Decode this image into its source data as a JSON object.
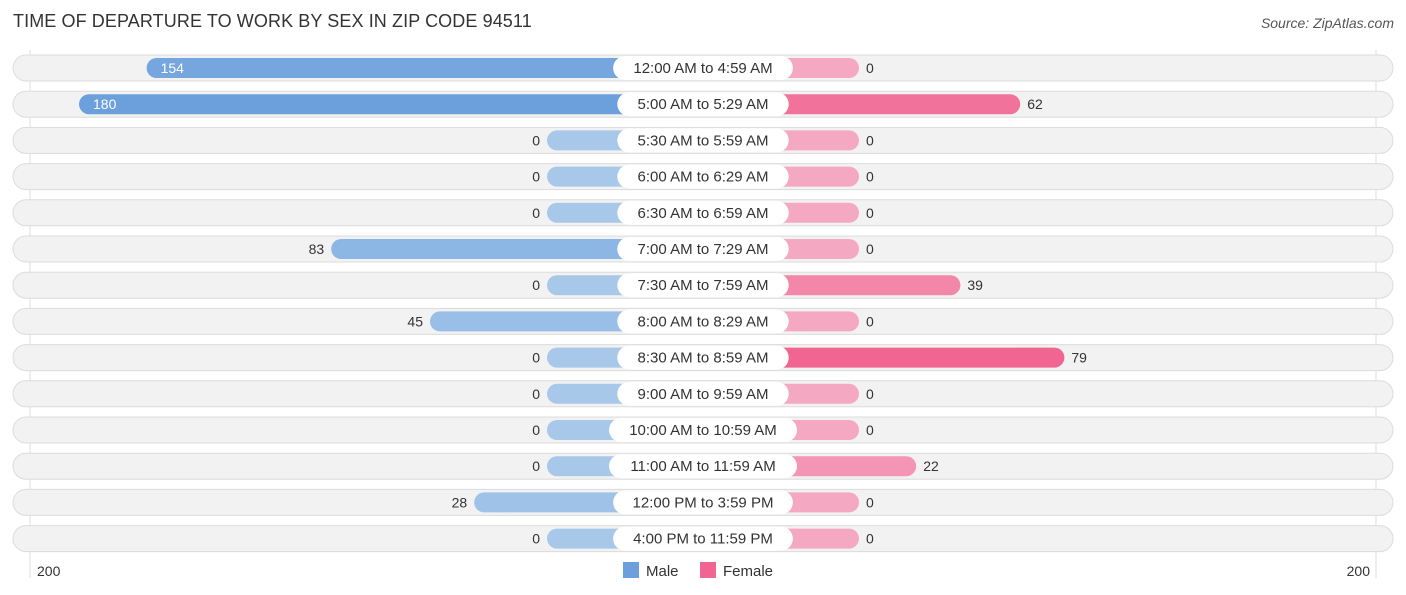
{
  "header": {
    "title": "TIME OF DEPARTURE TO WORK BY SEX IN ZIP CODE 94511",
    "source": "Source: ZipAtlas.com"
  },
  "colors": {
    "male": "#6ca0dc",
    "male_light": "#a8c8ea",
    "female": "#f06592",
    "female_light": "#f5a8c2",
    "row_bg": "#f2f2f2"
  },
  "chart_data": {
    "type": "bar",
    "orientation": "horizontal-diverging",
    "title": "TIME OF DEPARTURE TO WORK BY SEX IN ZIP CODE 94511",
    "categories": [
      "12:00 AM to 4:59 AM",
      "5:00 AM to 5:29 AM",
      "5:30 AM to 5:59 AM",
      "6:00 AM to 6:29 AM",
      "6:30 AM to 6:59 AM",
      "7:00 AM to 7:29 AM",
      "7:30 AM to 7:59 AM",
      "8:00 AM to 8:29 AM",
      "8:30 AM to 8:59 AM",
      "9:00 AM to 9:59 AM",
      "10:00 AM to 10:59 AM",
      "11:00 AM to 11:59 AM",
      "12:00 PM to 3:59 PM",
      "4:00 PM to 11:59 PM"
    ],
    "series": [
      {
        "name": "Male",
        "values": [
          154,
          180,
          0,
          0,
          0,
          83,
          0,
          45,
          0,
          0,
          0,
          0,
          28,
          0
        ]
      },
      {
        "name": "Female",
        "values": [
          0,
          62,
          0,
          0,
          0,
          0,
          39,
          0,
          79,
          0,
          0,
          22,
          0,
          0
        ]
      }
    ],
    "axis": {
      "left_label": "200",
      "right_label": "200",
      "max": 200
    },
    "legend": {
      "position": "bottom-center",
      "items": [
        "Male",
        "Female"
      ]
    }
  }
}
